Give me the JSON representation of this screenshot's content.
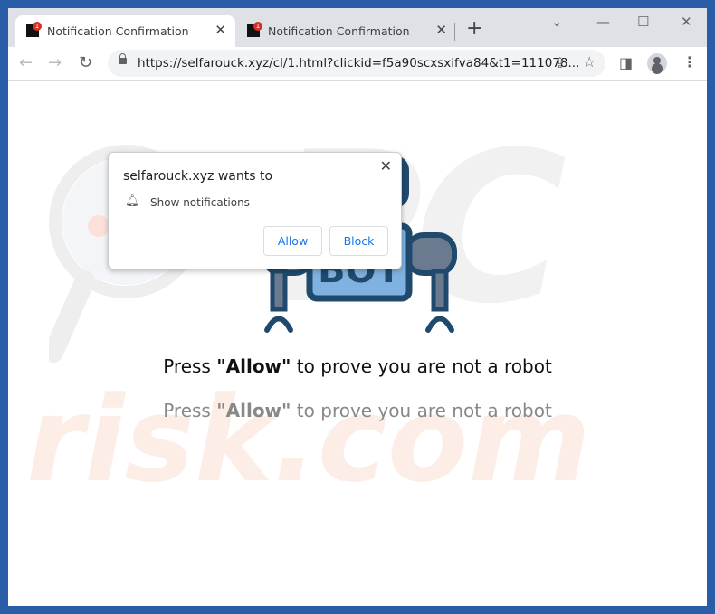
{
  "tabs": [
    {
      "title": "Notification Confirmation",
      "badge": "1",
      "active": true
    },
    {
      "title": "Notification Confirmation",
      "badge": "1",
      "active": false
    }
  ],
  "address": {
    "url": "https://selfarouck.xyz/cl/1.html?clickid=f5a90scxsxifva84&t1=111078..."
  },
  "popup": {
    "heading": "selfarouck.xyz wants to",
    "permission": "Show notifications",
    "allow": "Allow",
    "block": "Block"
  },
  "robot": {
    "label": "BOT"
  },
  "message": {
    "prefix": "Press ",
    "quote_word": "\"Allow\"",
    "suffix": " to prove you are not a robot"
  },
  "watermark": "risk.com",
  "colors": {
    "frame": "#2a5da8",
    "robot_dark": "#1f4a6e",
    "robot_light": "#7fb2e0",
    "link": "#1a73e8"
  }
}
